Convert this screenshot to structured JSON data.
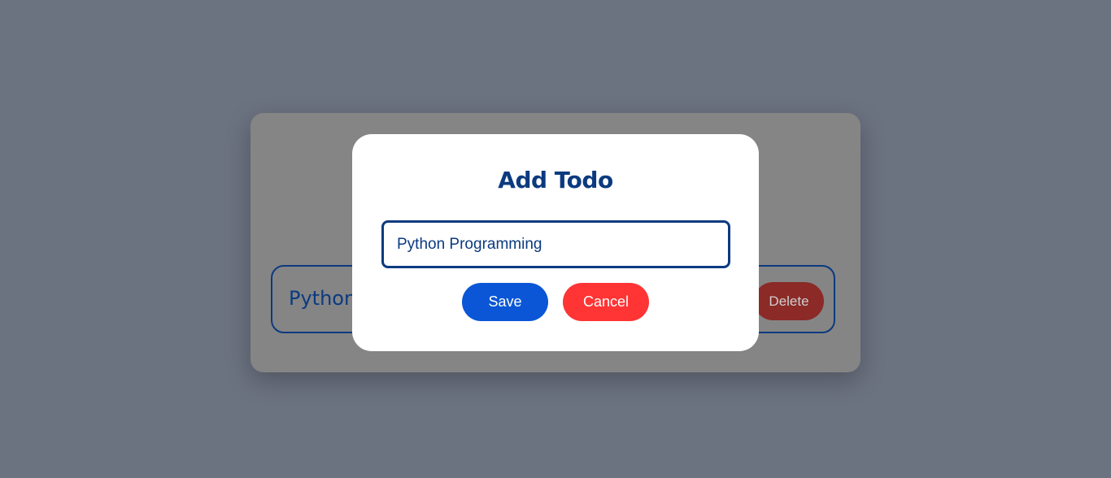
{
  "list": {
    "item_text": "Python",
    "delete_label": "Delete"
  },
  "modal": {
    "title": "Add Todo",
    "input_value": "Python Programming",
    "save_label": "Save",
    "cancel_label": "Cancel"
  },
  "colors": {
    "backdrop": "#6b7280",
    "primary": "#0b3a80",
    "save": "#0a56d6",
    "cancel": "#ff3434",
    "delete_dimmed": "#8b2a27"
  }
}
